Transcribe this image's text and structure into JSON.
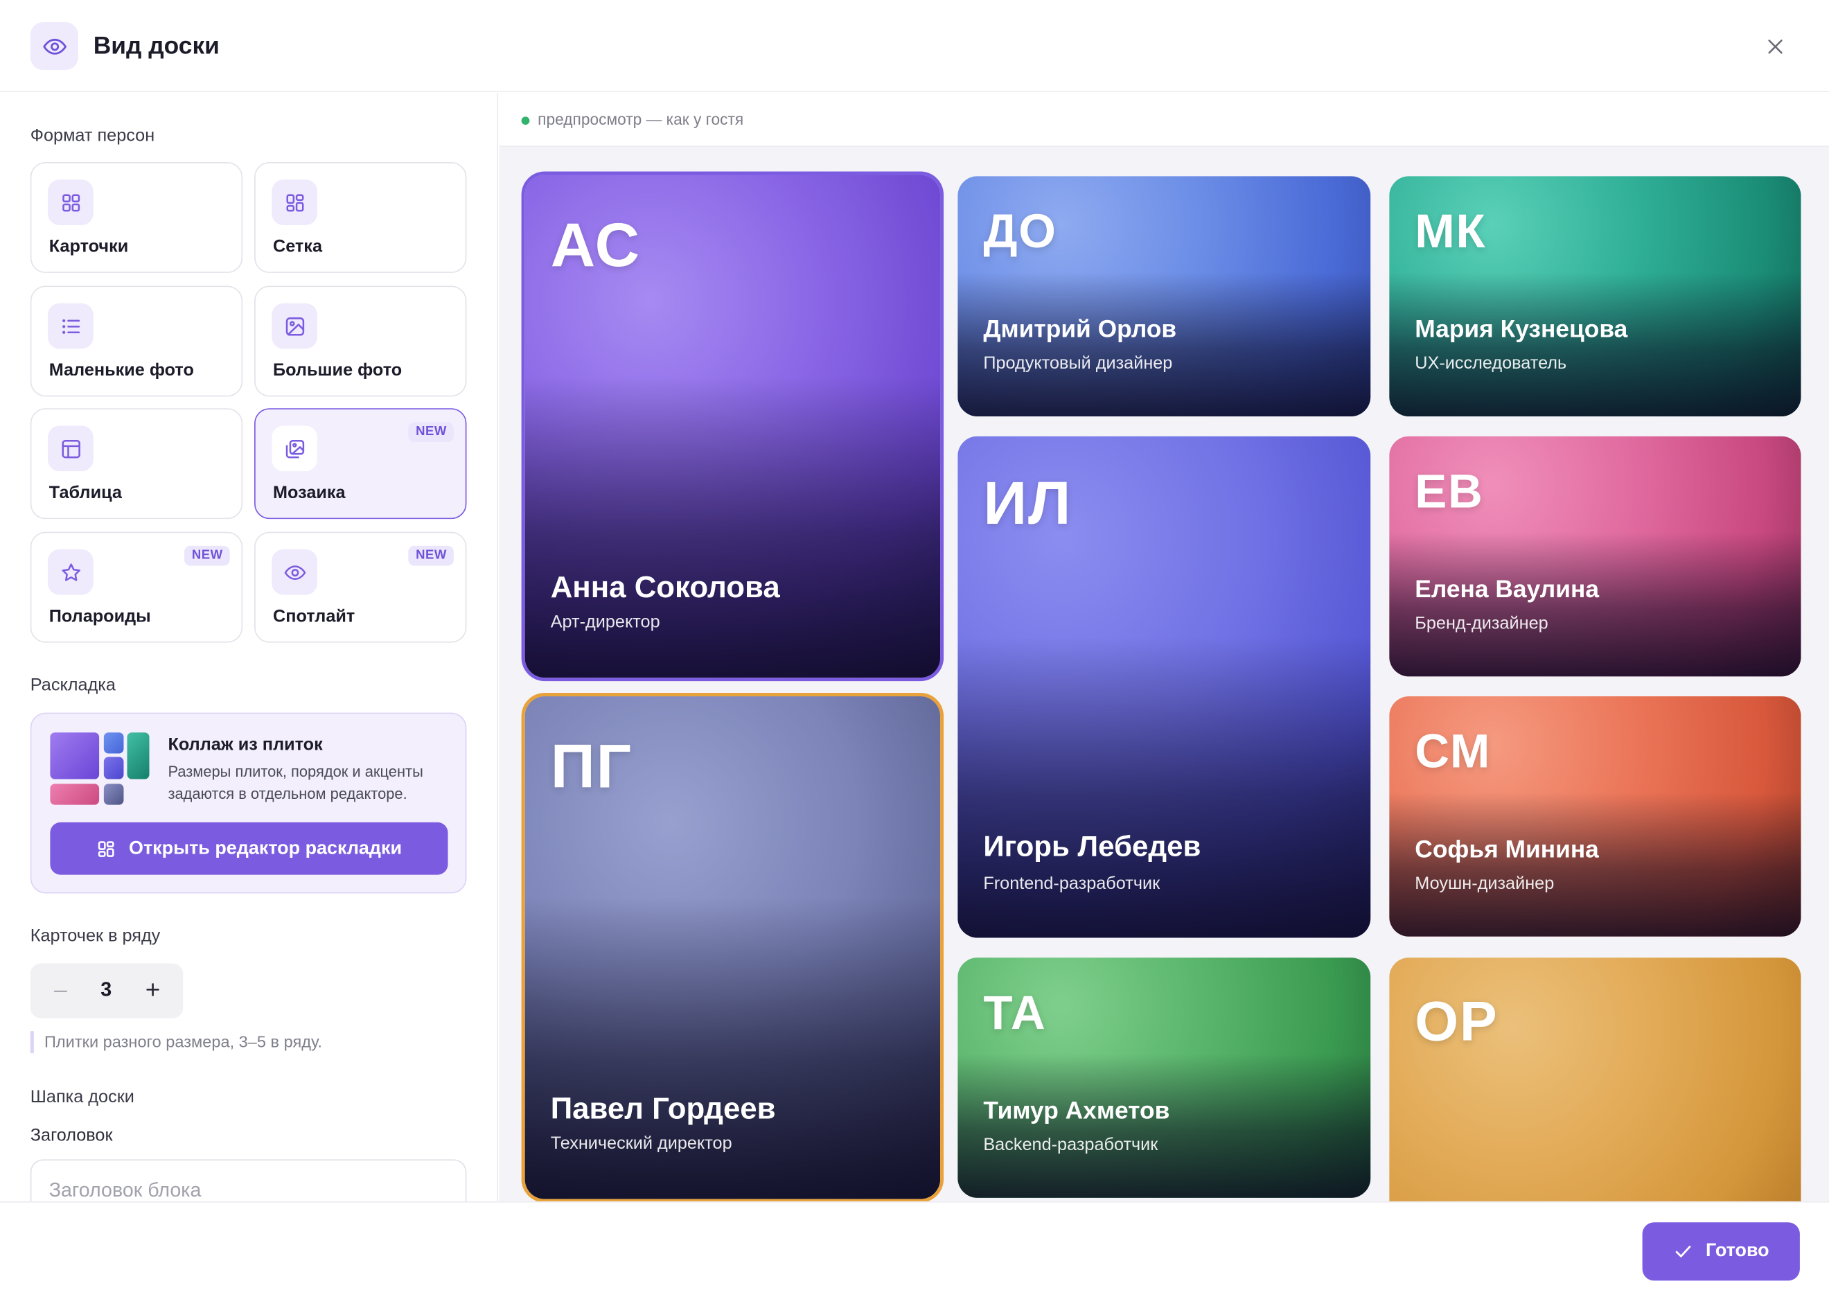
{
  "header": {
    "title": "Вид доски",
    "icon": "eye-icon"
  },
  "left": {
    "format_label": "Формат персон",
    "formats": [
      {
        "label": "Карточки",
        "icon": "grid-icon",
        "badge": ""
      },
      {
        "label": "Сетка",
        "icon": "grid-icon",
        "badge": ""
      },
      {
        "label": "Маленькие фото",
        "icon": "list-icon",
        "badge": ""
      },
      {
        "label": "Большие фото",
        "icon": "image-icon",
        "badge": ""
      },
      {
        "label": "Таблица",
        "icon": "table-icon",
        "badge": ""
      },
      {
        "label": "Мозаика",
        "icon": "gallery-icon",
        "badge": "NEW",
        "selected": true
      },
      {
        "label": "Полароиды",
        "icon": "star-icon",
        "badge": "NEW"
      },
      {
        "label": "Спотлайт",
        "icon": "eye-icon",
        "badge": "NEW"
      }
    ],
    "layout_label": "Раскладка",
    "layout": {
      "title": "Коллаж из плиток",
      "desc": "Размеры плиток, порядок и акценты задаются в отдельном редакторе.",
      "button": "Открыть редактор раскладки"
    },
    "per_row_label": "Карточек в ряду",
    "per_row_value": "3",
    "per_row_hint": "Плитки разного размера, 3–5 в ряду.",
    "board_header_label": "Шапка доски",
    "title_label": "Заголовок",
    "title_placeholder": "Заголовок блока",
    "title_value": ""
  },
  "preview": {
    "status": "предпросмотр — как у гостя",
    "people": [
      {
        "initials": "АС",
        "name": "Анна Соколова",
        "role": "Арт-директор",
        "accent": "#7b5ce0"
      },
      {
        "initials": "ДО",
        "name": "Дмитрий Орлов",
        "role": "Продуктовый дизайнер"
      },
      {
        "initials": "МК",
        "name": "Мария Кузнецова",
        "role": "UX-исследователь"
      },
      {
        "initials": "ИЛ",
        "name": "Игорь Лебедев",
        "role": "Frontend-разработчик"
      },
      {
        "initials": "ЕВ",
        "name": "Елена Ваулина",
        "role": "Бренд-дизайнер"
      },
      {
        "initials": "ПГ",
        "name": "Павел Гордеев",
        "role": "Технический директор",
        "accent": "#e9a23b"
      },
      {
        "initials": "СМ",
        "name": "Софья Минина",
        "role": "Моушн-дизайнер"
      },
      {
        "initials": "ТА",
        "name": "Тимур Ахметов",
        "role": "Backend-разработчик"
      },
      {
        "initials": "ОР",
        "name": "",
        "role": ""
      }
    ]
  },
  "footer": {
    "done": "Готово"
  },
  "colors": {
    "accent": "#7b5ce0",
    "accent_soft": "#efeafc",
    "selected_orange": "#e9a23b",
    "status_green": "#31b36b"
  }
}
